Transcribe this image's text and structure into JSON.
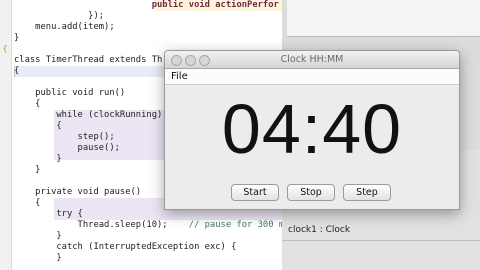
{
  "editor": {
    "lines": [
      "                          public void actionPerfor",
      "              });",
      "    menu.add(item);",
      "}",
      "",
      "class TimerThread extends Th",
      "{",
      "    public void run()",
      "    {",
      "        while (clockRunning)",
      "        {",
      "            step();",
      "            pause();",
      "        }",
      "    }",
      "",
      "    private void pause()",
      "    {",
      "        try {",
      "            Thread.sleep(10);",
      "        }",
      "        catch (InterruptedException exc) {",
      "        }",
      "    }"
    ],
    "comment": "// pause for 300 m"
  },
  "background_window": {
    "status": "clock1 : Clock"
  },
  "clock_window": {
    "title": "Clock HH:MM",
    "menu": {
      "file": "File"
    },
    "display": "04:40",
    "buttons": {
      "start": "Start",
      "stop": "Stop",
      "step": "Step"
    }
  }
}
